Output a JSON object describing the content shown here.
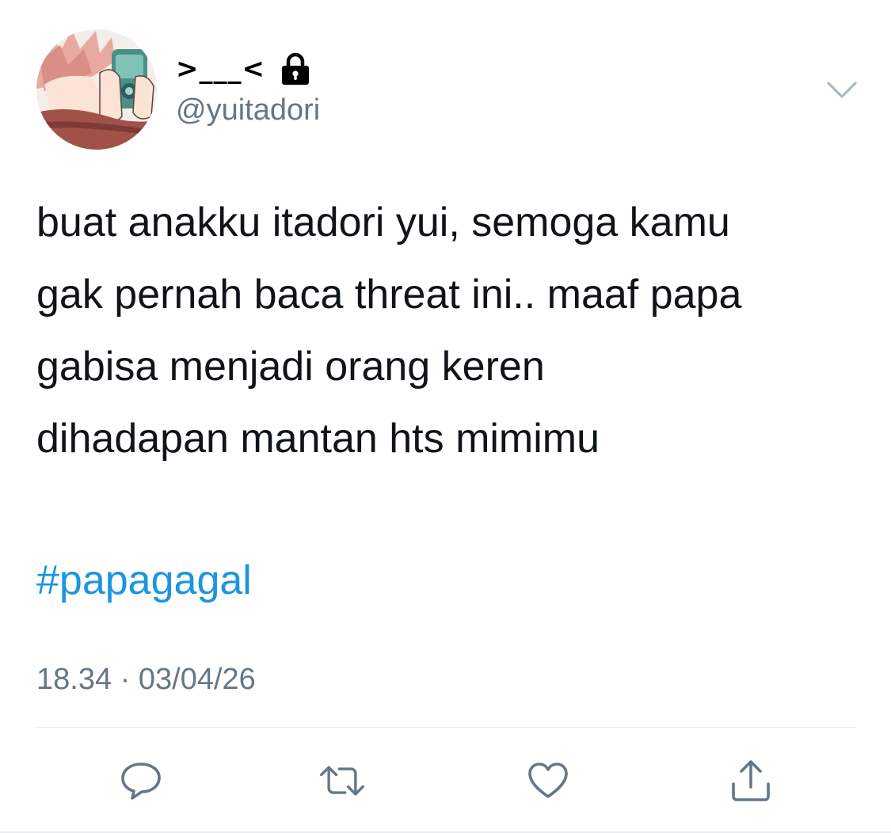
{
  "user": {
    "display_name": ">___<",
    "handle": "@yuitadori",
    "avatar_icon": "avatar-photo",
    "lock_icon": "lock-icon"
  },
  "tweet": {
    "lines": [
      "buat anakku itadori yui, semoga kamu",
      "gak pernah baca threat ini.. maaf papa",
      "gabisa menjadi orang keren",
      "dihadapan mantan hts mimimu"
    ],
    "hashtag": "#papagagal",
    "timestamp": "18.34 · 03/04/26"
  },
  "colors": {
    "hashtag": "#1b95e0",
    "secondary_text": "#657786",
    "divider": "#e1e8ed",
    "icon_gray": "#657786"
  },
  "actions": [
    {
      "icon": "reply-icon"
    },
    {
      "icon": "retweet-icon"
    },
    {
      "icon": "like-icon"
    },
    {
      "icon": "share-icon"
    }
  ],
  "menu": {
    "icon": "chevron-down-icon"
  }
}
